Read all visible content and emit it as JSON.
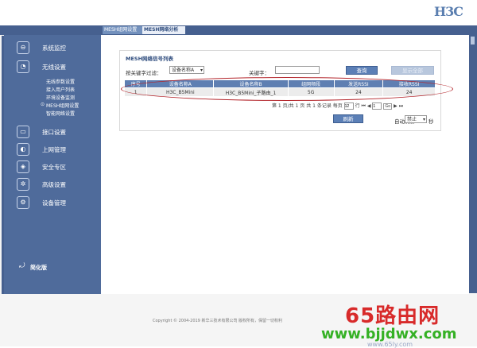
{
  "header": {
    "logo": "H3C"
  },
  "tabs": [
    {
      "label": "MESH组网设置"
    },
    {
      "label": "MESH网络分析"
    }
  ],
  "sidebar": {
    "items": [
      {
        "label": "系统监控",
        "icon": "monitor-icon"
      },
      {
        "label": "无线设置",
        "icon": "wifi-icon"
      },
      {
        "label": "接口设置",
        "icon": "interface-icon"
      },
      {
        "label": "上网管理",
        "icon": "internet-icon"
      },
      {
        "label": "安全专区",
        "icon": "shield-icon"
      },
      {
        "label": "高级设置",
        "icon": "gear-icon"
      },
      {
        "label": "设备管理",
        "icon": "device-icon"
      }
    ],
    "subitems": [
      {
        "label": "无线参数设置"
      },
      {
        "label": "接入用户列表"
      },
      {
        "label": "环境设备监测"
      },
      {
        "label": "MESH组网设置",
        "active": true
      },
      {
        "label": "智能网络设置"
      }
    ],
    "simple_mode": "简化版"
  },
  "panel": {
    "title": "MESH网络信号列表",
    "filter_label": "按关键字过滤：",
    "filter_value": "设备名称A",
    "keyword_label": "关键字：",
    "keyword_value": "",
    "search_button": "查询",
    "show_all_button": "显示全部"
  },
  "table": {
    "headers": [
      "序号",
      "设备名称A",
      "设备名称B",
      "组网频段",
      "发送RSSI",
      "接收RSSI"
    ],
    "rows": [
      [
        "1",
        "H3C_B5Mini",
        "H3C_B5Mini_子路由_1",
        "5G",
        "24",
        "24"
      ]
    ]
  },
  "pager": {
    "text": "第 1 页/共 1 页 共 1 条记录 每页",
    "per_page": "12",
    "unit": "行",
    "page_input": "1",
    "go": "Go"
  },
  "actions": {
    "refresh_button": "刷新",
    "auto_refresh_label": "自动刷新:",
    "auto_refresh_value": "禁止",
    "auto_refresh_unit": "秒"
  },
  "footer": {
    "copyright": "Copyright © 2004-2019 新华三技术有限公司 版权所有，保留一切权利"
  },
  "watermark": {
    "line1": "65路由网",
    "line2": "www.bjjdwx.com",
    "line3": "www.65ly.com"
  },
  "colors": {
    "nav": "#46608f",
    "sidebar": "#4f6b9b",
    "highlight_oval": "#b3242a",
    "watermark_red": "#d82a2a",
    "watermark_green": "#35b125"
  }
}
